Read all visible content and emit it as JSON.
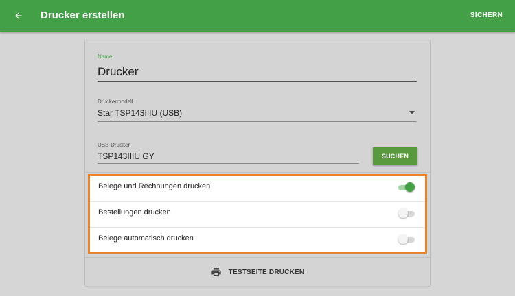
{
  "appbar": {
    "title": "Drucker erstellen",
    "save_label": "SICHERN",
    "back_icon": "arrow-left-icon",
    "color": "#43a047"
  },
  "form": {
    "name": {
      "label": "Name",
      "value": "Drucker"
    },
    "model": {
      "label": "Druckermodell",
      "value": "Star TSP143IIIU (USB)"
    },
    "usb": {
      "label": "USB-Drucker",
      "value": "TSP143IIIU GY",
      "search_label": "SUCHEN"
    }
  },
  "toggles": [
    {
      "label": "Belege und Rechnungen drucken",
      "on": true
    },
    {
      "label": "Bestellungen drucken",
      "on": false
    },
    {
      "label": "Belege automatisch drucken",
      "on": false
    }
  ],
  "print_test": {
    "label": "TESTSEITE DRUCKEN",
    "icon": "printer-icon"
  },
  "highlight_color": "#e8822c"
}
